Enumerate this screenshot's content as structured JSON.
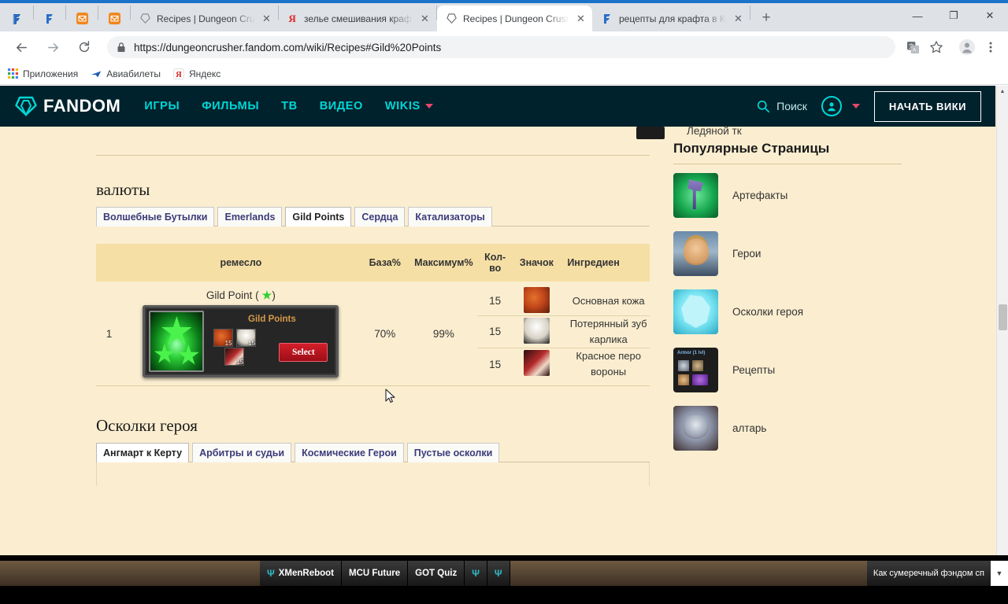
{
  "browser": {
    "pinned_tabs": [
      {
        "icon": "fandom-f-icon",
        "name": "pinned-tab-fandom-1"
      },
      {
        "icon": "fandom-f-icon",
        "name": "pinned-tab-fandom-2"
      },
      {
        "icon": "mail-icon",
        "name": "pinned-tab-mail-1"
      },
      {
        "icon": "mail-icon",
        "name": "pinned-tab-mail-2"
      }
    ],
    "tabs": [
      {
        "title": "Recipes | Dungeon Crusher W",
        "icon": "fandom-heart-icon",
        "active": false
      },
      {
        "title": "зелье смешивания крафт кру",
        "icon": "yandex-icon",
        "active": false
      },
      {
        "title": "Recipes | Dungeon Crusher W",
        "icon": "fandom-heart-icon",
        "active": true
      },
      {
        "title": "рецепты для крафта в Круш",
        "icon": "fandom-f-icon",
        "active": false
      }
    ],
    "new_tab_label": "+",
    "close_label": "✕",
    "window_controls": {
      "minimize": "—",
      "maximize": "❐",
      "close": "✕"
    },
    "url": "https://dungeoncrusher.fandom.com/wiki/Recipes#Gild%20Points",
    "bookmarks": [
      {
        "label": "Приложения",
        "icon": "apps-grid-icon"
      },
      {
        "label": "Авиабилеты",
        "icon": "airplane-icon"
      },
      {
        "label": "Яндекс",
        "icon": "yandex-icon"
      }
    ]
  },
  "fandom": {
    "logo_text": "FANDOM",
    "nav": [
      "ИГРЫ",
      "ФИЛЬМЫ",
      "ТВ",
      "ВИДЕО",
      "WIKIS"
    ],
    "search_label": "Поиск",
    "start_wiki_label": "НАЧАТЬ ВИКИ"
  },
  "page": {
    "clipped_top_row_text": "Ледяной тк",
    "sections": [
      {
        "title": "валюты",
        "tabs": [
          {
            "label": "Волшебные Бутылки",
            "active": false
          },
          {
            "label": "Emerlands",
            "active": false
          },
          {
            "label": "Gild Points",
            "active": true
          },
          {
            "label": "Сердца",
            "active": false
          },
          {
            "label": "Катализаторы",
            "active": false
          }
        ],
        "table": {
          "headers": [
            "",
            "ремесло",
            "База%",
            "Максимум%",
            "Кол-во",
            "Значок",
            "Ингредиен"
          ],
          "rows": [
            {
              "num": "1",
              "craft_label": "Gild Point (",
              "craft_label_close": ")",
              "card": {
                "title": "Gild Points",
                "select_label": "Select",
                "materials": [
                  {
                    "name": "leather-material-icon",
                    "qty": "15"
                  },
                  {
                    "name": "tooth-material-icon",
                    "qty": "15"
                  },
                  {
                    "name": "feather-material-icon",
                    "qty": "15"
                  }
                ]
              },
              "base": "70%",
              "max": "99%",
              "ingredients": [
                {
                  "qty": "15",
                  "icon": "basic-leather-icon",
                  "name": "Основная кожа"
                },
                {
                  "qty": "15",
                  "icon": "dwarf-tooth-icon",
                  "name": "Потерянный зуб карлика"
                },
                {
                  "qty": "15",
                  "icon": "red-crow-feather-icon",
                  "name": "Красное перо вороны"
                }
              ]
            }
          ]
        }
      },
      {
        "title": "Осколки героя",
        "tabs": [
          {
            "label": "Ангмарт к Керту",
            "active": true
          },
          {
            "label": "Арбитры и судьи",
            "active": false
          },
          {
            "label": "Космические Герои",
            "active": false
          },
          {
            "label": "Пустые осколки",
            "active": false
          }
        ]
      }
    ],
    "sidebar": {
      "title": "Популярные Страницы",
      "items": [
        {
          "label": "Артефакты",
          "thumb": "artifact-axe-thumb"
        },
        {
          "label": "Герои",
          "thumb": "hero-portrait-thumb"
        },
        {
          "label": "Осколки героя",
          "thumb": "hero-shard-thumb"
        },
        {
          "label": "Рецепты",
          "thumb": "recipes-thumb",
          "thumb_label": "Armor (1 lvl)"
        },
        {
          "label": "алтарь",
          "thumb": "altar-beast-thumb"
        }
      ]
    }
  },
  "bottom_widget": {
    "items": [
      {
        "label": "XMenReboot",
        "icon": "trident-icon"
      },
      {
        "label": "MCU Future",
        "icon": null
      },
      {
        "label": "GOT Quiz",
        "icon": null
      },
      {
        "label": "",
        "icon": "trident-icon"
      },
      {
        "label": "",
        "icon": "trident-icon"
      }
    ],
    "right_text": "Как сумеречный фэндом сп"
  },
  "colors": {
    "fandom_dark": "#00222c",
    "fandom_teal": "#00d6d6",
    "page_bg": "#fbeed0",
    "table_header_bg": "#f6dfa5",
    "tab_link": "#3b3b7a",
    "select_button": "#d41f2a"
  }
}
